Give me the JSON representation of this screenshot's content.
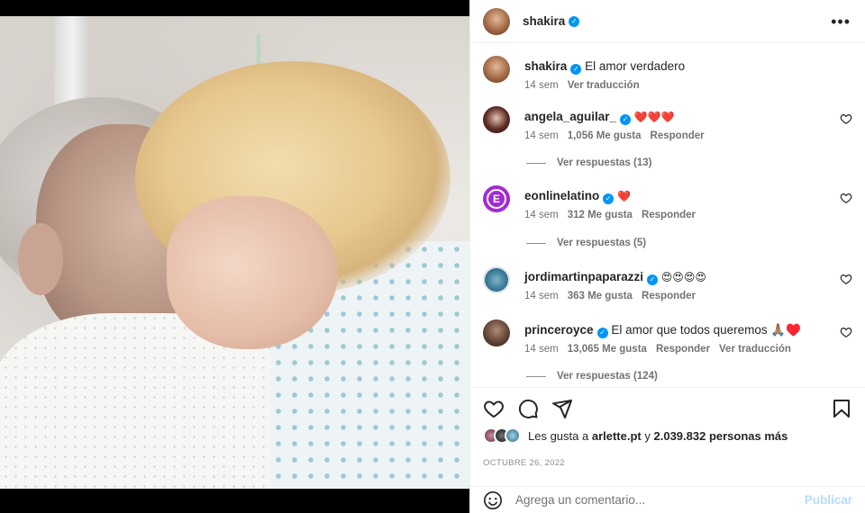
{
  "post": {
    "username": "shakira",
    "verified": true
  },
  "caption": {
    "username": "shakira",
    "text": "El amor verdadero",
    "time": "14 sem",
    "translate": "Ver traducción"
  },
  "comments": [
    {
      "username": "angela_aguilar_",
      "text": "❤️❤️❤️",
      "time": "14 sem",
      "likes": "1,056 Me gusta",
      "reply": "Responder",
      "view_replies": "Ver respuestas (13)"
    },
    {
      "username": "eonlinelatino",
      "text": "❤️",
      "time": "14 sem",
      "likes": "312 Me gusta",
      "reply": "Responder",
      "view_replies": "Ver respuestas (5)"
    },
    {
      "username": "jordimartinpaparazzi",
      "text": "😍😍😍😍",
      "time": "14 sem",
      "likes": "363 Me gusta",
      "reply": "Responder"
    },
    {
      "username": "princeroyce",
      "text": "El amor que todos queremos 🙏🏽♥️",
      "time": "14 sem",
      "likes": "13,065 Me gusta",
      "reply": "Responder",
      "translate": "Ver traducción",
      "view_replies": "Ver respuestas (124)"
    }
  ],
  "likes_summary": {
    "prefix": "Les gusta a ",
    "user": "arlette.pt",
    "middle": " y ",
    "count": "2.039.832 personas más"
  },
  "date": "OCTUBRE 26, 2022",
  "composer": {
    "placeholder": "Agrega un comentario...",
    "publish": "Publicar"
  },
  "icons": {
    "more": "more-options-icon",
    "like": "heart-icon",
    "comment": "comment-icon",
    "share": "share-icon",
    "save": "bookmark-icon",
    "emoji": "emoji-icon"
  },
  "colors": {
    "verified": "#0095f6",
    "publish_disabled": "#b2dffc"
  }
}
